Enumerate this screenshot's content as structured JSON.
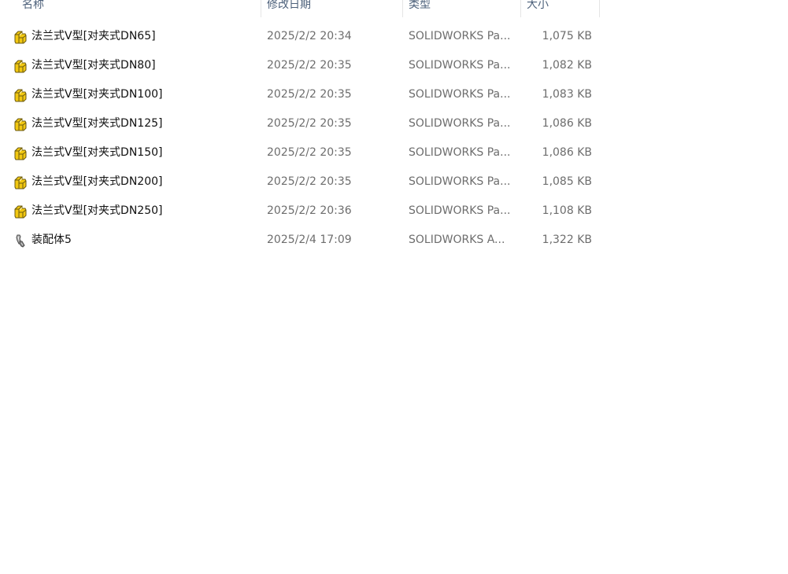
{
  "columns": {
    "name": "名称",
    "date": "修改日期",
    "type": "类型",
    "size": "大小"
  },
  "files": [
    {
      "name": "法兰式V型[对夹式DN65]",
      "date": "2025/2/2 20:34",
      "type": "SOLIDWORKS Pa...",
      "size": "1,075 KB",
      "icon": "solidworks-part-icon"
    },
    {
      "name": "法兰式V型[对夹式DN80]",
      "date": "2025/2/2 20:35",
      "type": "SOLIDWORKS Pa...",
      "size": "1,082 KB",
      "icon": "solidworks-part-icon"
    },
    {
      "name": "法兰式V型[对夹式DN100]",
      "date": "2025/2/2 20:35",
      "type": "SOLIDWORKS Pa...",
      "size": "1,083 KB",
      "icon": "solidworks-part-icon"
    },
    {
      "name": "法兰式V型[对夹式DN125]",
      "date": "2025/2/2 20:35",
      "type": "SOLIDWORKS Pa...",
      "size": "1,086 KB",
      "icon": "solidworks-part-icon"
    },
    {
      "name": "法兰式V型[对夹式DN150]",
      "date": "2025/2/2 20:35",
      "type": "SOLIDWORKS Pa...",
      "size": "1,086 KB",
      "icon": "solidworks-part-icon"
    },
    {
      "name": "法兰式V型[对夹式DN200]",
      "date": "2025/2/2 20:35",
      "type": "SOLIDWORKS Pa...",
      "size": "1,085 KB",
      "icon": "solidworks-part-icon"
    },
    {
      "name": "法兰式V型[对夹式DN250]",
      "date": "2025/2/2 20:36",
      "type": "SOLIDWORKS Pa...",
      "size": "1,108 KB",
      "icon": "solidworks-part-icon"
    },
    {
      "name": "装配体5",
      "date": "2025/2/4 17:09",
      "type": "SOLIDWORKS A...",
      "size": "1,322 KB",
      "icon": "solidworks-assembly-icon"
    }
  ],
  "colors": {
    "header_text": "#4c607a",
    "meta_text": "#6d6d6d",
    "part_icon": "#f2c811"
  }
}
